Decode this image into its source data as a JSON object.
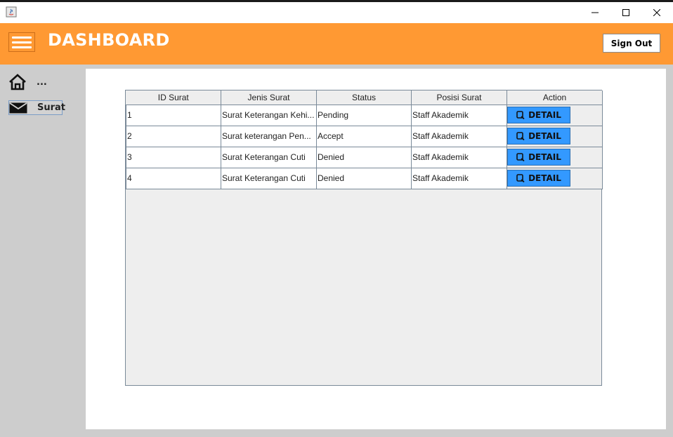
{
  "window": {
    "controls": {
      "minimize_icon": "minimize-icon",
      "maximize_icon": "maximize-icon",
      "close_icon": "close-icon"
    }
  },
  "header": {
    "title": "DASHBOARD",
    "signout_label": "Sign Out",
    "accent_color": "#ff9933"
  },
  "sidebar": {
    "items": [
      {
        "label": "...",
        "icon": "home-icon"
      },
      {
        "label": "Surat",
        "icon": "mail-icon"
      }
    ]
  },
  "table": {
    "columns": [
      "ID Surat",
      "Jenis Surat",
      "Status",
      "Posisi Surat",
      "Action"
    ],
    "rows": [
      {
        "id": "1",
        "jenis": "Surat Keterangan Kehi...",
        "status": "Pending",
        "posisi": "Staff Akademik",
        "action": "DETAIL"
      },
      {
        "id": "2",
        "jenis": "Surat keterangan Pen...",
        "status": "Accept",
        "posisi": "Staff Akademik",
        "action": "DETAIL"
      },
      {
        "id": "3",
        "jenis": "Surat Keterangan Cuti",
        "status": "Denied",
        "posisi": "Staff Akademik",
        "action": "DETAIL"
      },
      {
        "id": "4",
        "jenis": "Surat Keterangan Cuti",
        "status": "Denied",
        "posisi": "Staff Akademik",
        "action": "DETAIL"
      }
    ],
    "button_color": "#3399ff"
  }
}
